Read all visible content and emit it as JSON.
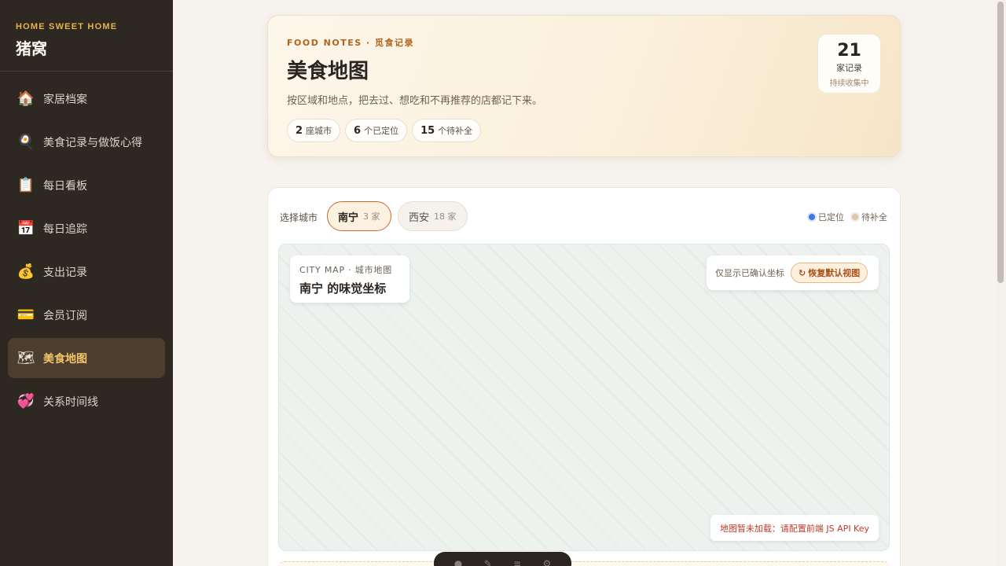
{
  "brand": {
    "subtitle": "HOME SWEET HOME",
    "title": "猪窝"
  },
  "sidebar": {
    "items": [
      {
        "label": "家居档案",
        "icon": "🏠",
        "icon_name": "house-icon",
        "active": false
      },
      {
        "label": "美食记录与做饭心得",
        "icon": "🍳",
        "icon_name": "frying-pan-icon",
        "active": false
      },
      {
        "label": "每日看板",
        "icon": "📋",
        "icon_name": "clipboard-icon",
        "active": false
      },
      {
        "label": "每日追踪",
        "icon": "📅",
        "icon_name": "calendar-icon",
        "active": false
      },
      {
        "label": "支出记录",
        "icon": "💰",
        "icon_name": "money-bag-icon",
        "active": false
      },
      {
        "label": "会员订阅",
        "icon": "💳",
        "icon_name": "credit-card-icon",
        "active": false
      },
      {
        "label": "美食地图",
        "icon": "🗺",
        "icon_name": "map-icon",
        "active": true
      },
      {
        "label": "关系时间线",
        "icon": "💞",
        "icon_name": "hearts-icon",
        "active": false
      }
    ]
  },
  "hero": {
    "eyebrow": "FOOD NOTES · 觅食记录",
    "title": "美食地图",
    "description": "按区域和地点，把去过、想吃和不再推荐的店都记下来。",
    "stats": [
      {
        "value": "2",
        "label": "座城市"
      },
      {
        "value": "6",
        "label": "个已定位"
      },
      {
        "value": "15",
        "label": "个待补全"
      }
    ],
    "count": {
      "value": "21",
      "unit": "家记录",
      "note": "持续收集中"
    }
  },
  "cities": {
    "label": "选择城市",
    "items": [
      {
        "name": "南宁",
        "count": "3 家",
        "active": true
      },
      {
        "name": "西安",
        "count": "18 家",
        "active": false
      }
    ]
  },
  "legend": {
    "located": {
      "label": "已定位",
      "color": "#3b7be0"
    },
    "pending": {
      "label": "待补全",
      "color": "#d9c7b0"
    }
  },
  "map": {
    "eyebrow": "CITY MAP · 城市地图",
    "title": "南宁 的味觉坐标",
    "filter_text": "仅显示已确认坐标",
    "reset_label": "恢复默认视图",
    "notice": "地图暂未加载：请配置前端 JS API Key"
  }
}
